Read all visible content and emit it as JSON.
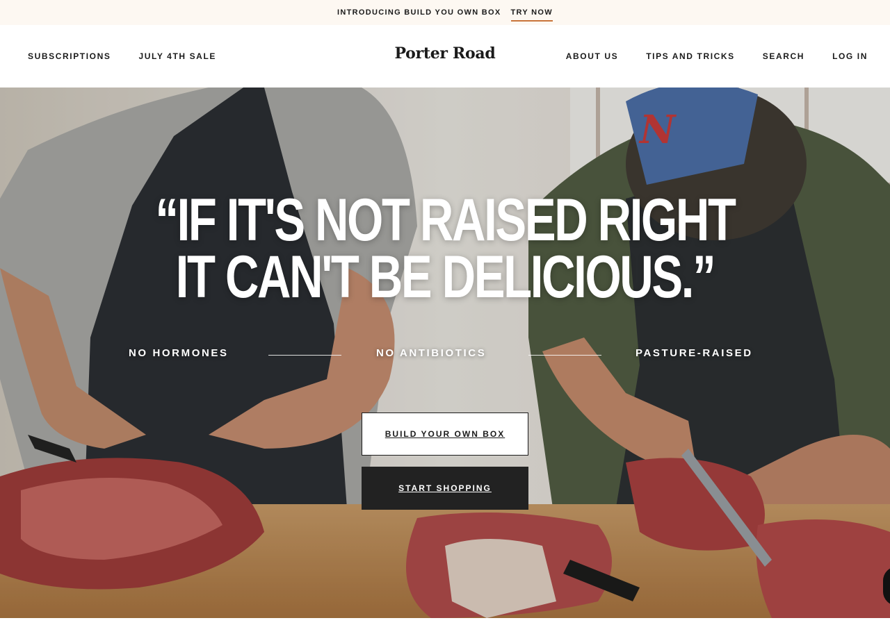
{
  "announcement": {
    "text": "INTRODUCING BUILD YOU OWN BOX",
    "link": "TRY NOW"
  },
  "header": {
    "logo": "Porter Road",
    "nav_left": [
      "SUBSCRIPTIONS",
      "JULY 4TH SALE"
    ],
    "nav_right": [
      "ABOUT US",
      "TIPS AND TRICKS",
      "SEARCH",
      "LOG IN"
    ]
  },
  "hero": {
    "headline_line1": "“IF IT'S NOT RAISED RIGHT",
    "headline_line2": "IT CAN'T BE DELICIOUS.”",
    "features": [
      "NO HORMONES",
      "NO ANTIBIOTICS",
      "PASTURE-RAISED"
    ],
    "primary_button": "BUILD YOUR OWN BOX",
    "secondary_button": "START SHOPPING",
    "photo": "butchers-cutting-meat-photo"
  },
  "colors": {
    "announcement_bg": "#fdf8f2",
    "link_underline": "#c9743a",
    "dark_button": "#222222",
    "text": "#1a1a1a"
  }
}
